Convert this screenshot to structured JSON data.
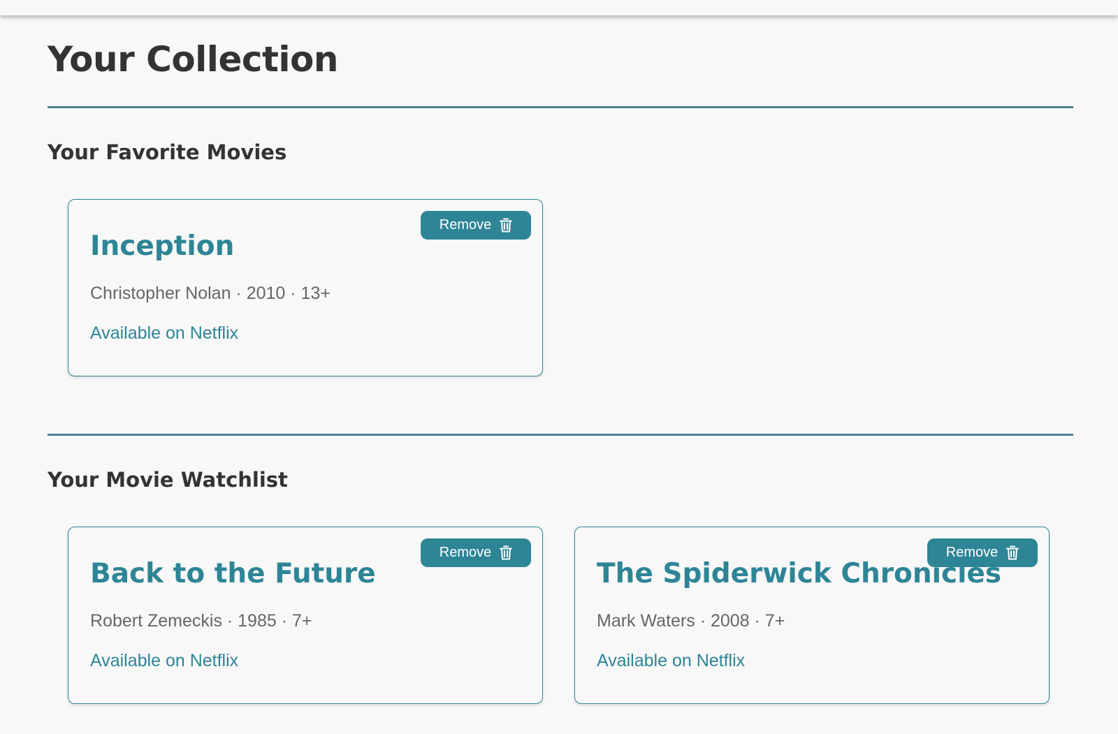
{
  "page": {
    "title": "Your Collection"
  },
  "colors": {
    "accent": "#2d8596",
    "heading": "#333333",
    "meta_text": "#666666",
    "background": "#f8f8f8"
  },
  "favorites": {
    "title": "Your Favorite Movies",
    "items": [
      {
        "title": "Inception",
        "director": "Christopher Nolan",
        "year": "2010",
        "rating": "13+",
        "meta": "Christopher Nolan · 2010 · 13+",
        "availability": "Available on Netflix",
        "remove_label": "Remove",
        "remove_icon": "trash-icon"
      }
    ]
  },
  "watchlist": {
    "title": "Your Movie Watchlist",
    "items": [
      {
        "title": "Back to the Future",
        "director": "Robert Zemeckis",
        "year": "1985",
        "rating": "7+",
        "meta": "Robert Zemeckis · 1985 · 7+",
        "availability": "Available on Netflix",
        "remove_label": "Remove",
        "remove_icon": "trash-icon"
      },
      {
        "title": "The Spiderwick Chronicles",
        "director": "Mark Waters",
        "year": "2008",
        "rating": "7+",
        "meta": "Mark Waters · 2008 · 7+",
        "availability": "Available on Netflix",
        "remove_label": "Remove",
        "remove_icon": "trash-icon"
      }
    ]
  }
}
